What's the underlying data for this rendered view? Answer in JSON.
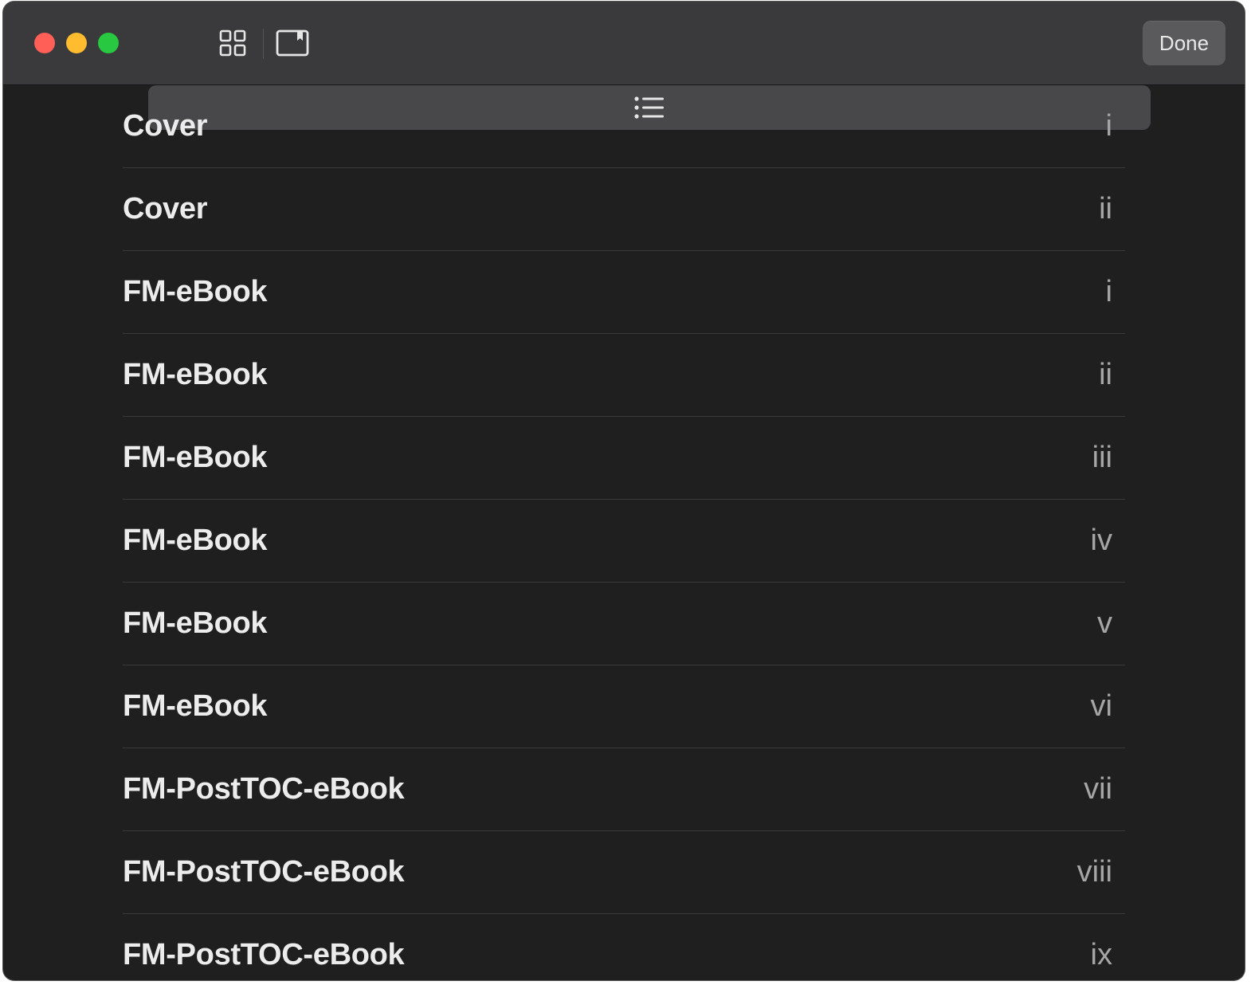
{
  "toolbar": {
    "done_label": "Done",
    "view_buttons": [
      {
        "icon": "list-icon",
        "active": true
      },
      {
        "icon": "grid-icon",
        "active": false
      },
      {
        "icon": "bookmark-icon",
        "active": false
      }
    ]
  },
  "colors": {
    "close": "#ff5f57",
    "minimize": "#febc2e",
    "zoom": "#28c840",
    "background": "#1f1f1f",
    "titlebar": "#3a3a3c"
  },
  "toc": {
    "rows": [
      {
        "title": "Cover",
        "page": "i"
      },
      {
        "title": "Cover",
        "page": "ii"
      },
      {
        "title": "FM-eBook",
        "page": "i"
      },
      {
        "title": "FM-eBook",
        "page": "ii"
      },
      {
        "title": "FM-eBook",
        "page": "iii"
      },
      {
        "title": "FM-eBook",
        "page": "iv"
      },
      {
        "title": "FM-eBook",
        "page": "v"
      },
      {
        "title": "FM-eBook",
        "page": "vi"
      },
      {
        "title": "FM-PostTOC-eBook",
        "page": "vii"
      },
      {
        "title": "FM-PostTOC-eBook",
        "page": "viii"
      },
      {
        "title": "FM-PostTOC-eBook",
        "page": "ix"
      }
    ]
  }
}
